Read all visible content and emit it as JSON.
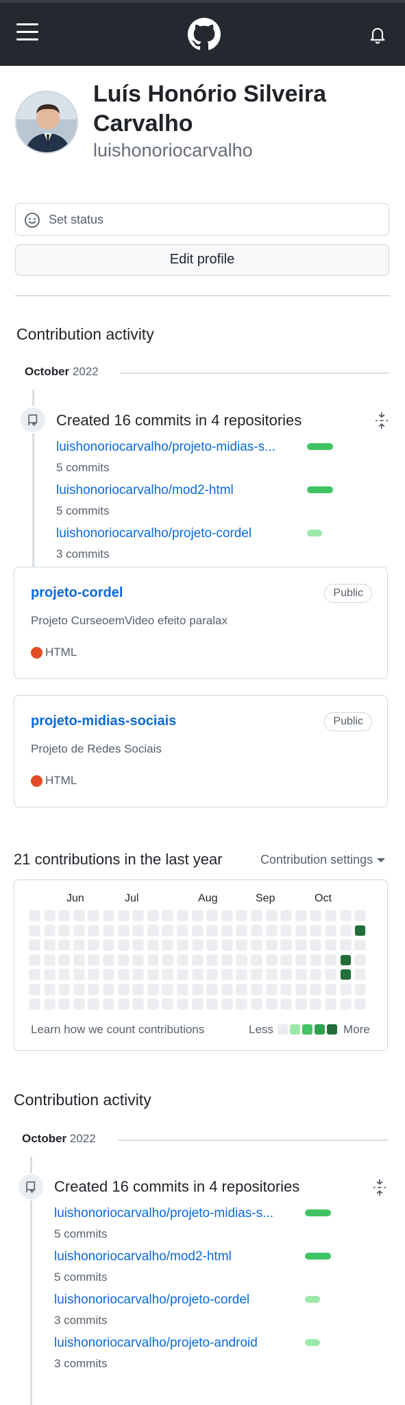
{
  "header": {
    "menu_icon": "hamburger-icon",
    "logo_icon": "github-logo-icon",
    "notifications_icon": "bell-icon"
  },
  "profile": {
    "name": "Luís Honório Silveira Carvalho",
    "login": "luishonoriocarvalho",
    "avatar_icon": "user-avatar",
    "set_status_label": "Set status",
    "status_icon": "smiley-icon",
    "edit_profile_label": "Edit profile"
  },
  "activity_top": {
    "title": "Contribution activity",
    "month": "October",
    "year": "2022",
    "summary": "Created 16 commits in 4 repositories",
    "repos": [
      {
        "name": "luishonoriocarvalho/projeto-midias-s...",
        "commits": "5 commits",
        "share": 1.0
      },
      {
        "name": "luishonoriocarvalho/mod2-html",
        "commits": "5 commits",
        "share": 1.0
      },
      {
        "name": "luishonoriocarvalho/projeto-cordel",
        "commits": "3 commits",
        "share": 0.6
      }
    ]
  },
  "cards": [
    {
      "title": "projeto-cordel",
      "badge": "Public",
      "description": "Projeto CurseoemVideo efeito paralax",
      "language": "HTML",
      "language_color": "#e34c26"
    },
    {
      "title": "projeto-midias-sociais",
      "badge": "Public",
      "description": "Projeto de Redes Sociais",
      "language": "HTML",
      "language_color": "#e34c26"
    }
  ],
  "contributions": {
    "heading": "21 contributions in the last year",
    "settings_label": "Contribution settings",
    "months": [
      "Jun",
      "Jul",
      "Aug",
      "Sep",
      "Oct"
    ],
    "footer_link": "Learn how we count contributions",
    "legend_less": "Less",
    "legend_more": "More",
    "colors": [
      "#ebedf0",
      "#9be9a8",
      "#40c463",
      "#30a14e",
      "#216e39"
    ],
    "active_cells": [
      {
        "week": 22,
        "day": 1,
        "level": 4
      },
      {
        "week": 21,
        "day": 3,
        "level": 4
      },
      {
        "week": 21,
        "day": 4,
        "level": 4
      }
    ]
  },
  "activity_bottom": {
    "title": "Contribution activity",
    "month": "October",
    "year": "2022",
    "summary": "Created 16 commits in 4 repositories",
    "repos": [
      {
        "name": "luishonoriocarvalho/projeto-midias-s...",
        "commits": "5 commits",
        "share": 1.0
      },
      {
        "name": "luishonoriocarvalho/mod2-html",
        "commits": "5 commits",
        "share": 1.0
      },
      {
        "name": "luishonoriocarvalho/projeto-cordel",
        "commits": "3 commits",
        "share": 0.6
      },
      {
        "name": "luishonoriocarvalho/projeto-android",
        "commits": "3 commits",
        "share": 0.6
      }
    ]
  }
}
